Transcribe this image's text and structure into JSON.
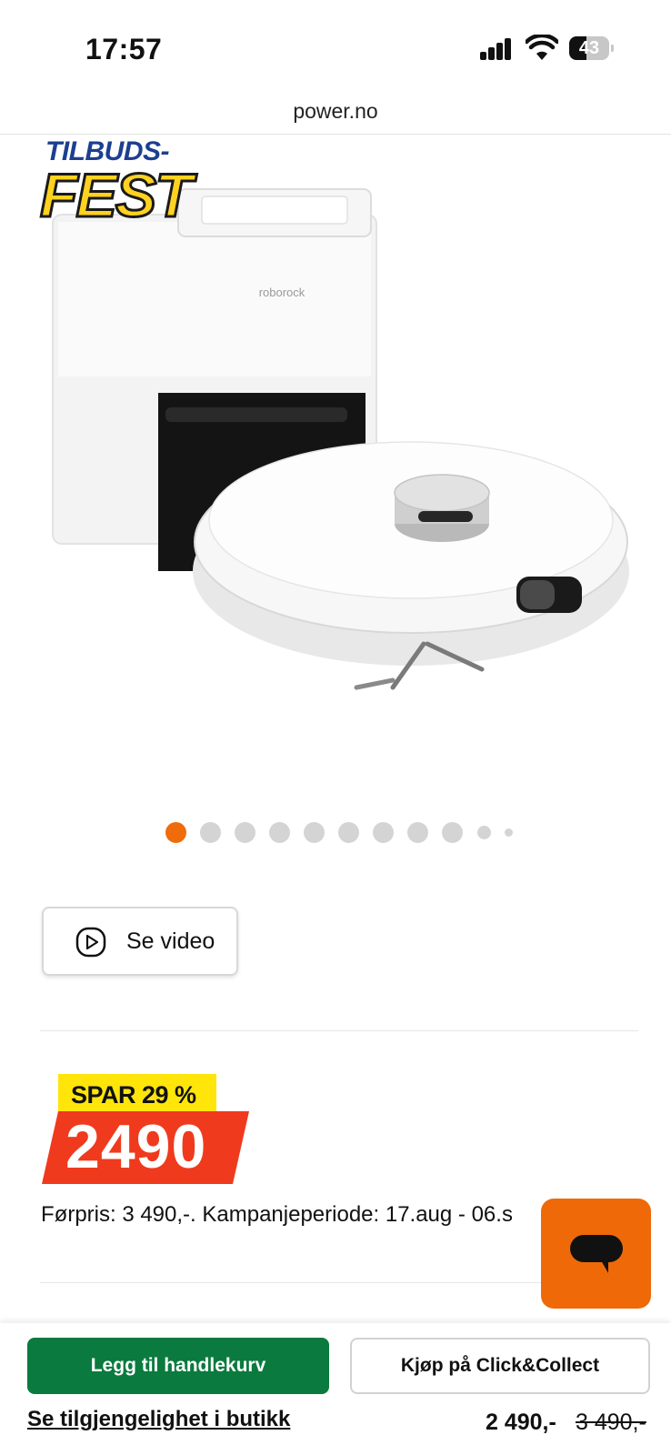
{
  "status_bar": {
    "time": "17:57",
    "battery_level": "43",
    "icons": [
      "cellular-signal-icon",
      "wifi-icon",
      "battery-icon"
    ]
  },
  "browser": {
    "url": "power.no"
  },
  "badge": {
    "line1": "TILBUDS-",
    "line2": "FEST"
  },
  "product_image": {
    "brand_text": "roborock"
  },
  "carousel": {
    "total": 11,
    "active_index": 0
  },
  "video_button": {
    "label": "Se video",
    "icon": "play-circle-icon"
  },
  "price": {
    "save_label": "SPAR 29 %",
    "current": "2490",
    "previous_info": "Førpris: 3 490,-. Kampanjeperiode: 17.aug - 06.s"
  },
  "chat": {
    "icon": "chat-bubble-icon"
  },
  "bottom_bar": {
    "add_to_cart": "Legg til handlekurv",
    "click_collect": "Kjøp på Click&Collect",
    "availability": "Se tilgjengelighet i butikk",
    "price": "2 490,-",
    "old_price": "3 490,-"
  },
  "colors": {
    "accent_orange": "#f06c0a",
    "primary_green": "#0a7a3e",
    "save_yellow": "#ffe50a",
    "price_red": "#f03a1e"
  }
}
